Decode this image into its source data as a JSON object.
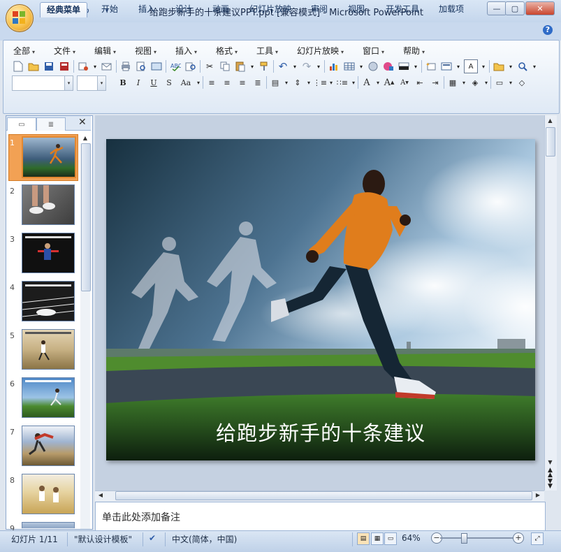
{
  "window": {
    "title": "给跑步新手的十条建议PPT.ppt [兼容模式] - Microsoft PowerPoint"
  },
  "tabs": [
    "经典菜单",
    "开始",
    "插入",
    "设计",
    "动画",
    "幻灯片放映",
    "审阅",
    "视图",
    "开发工具",
    "加载项"
  ],
  "menus": [
    "全部",
    "文件",
    "编辑",
    "视图",
    "插入",
    "格式",
    "工具",
    "幻灯片放映",
    "窗口",
    "帮助"
  ],
  "slide_panel": {
    "numbers": [
      "1",
      "2",
      "3",
      "4",
      "5",
      "6",
      "7",
      "8",
      "9"
    ],
    "selected": "1"
  },
  "slide": {
    "title": "给跑步新手的十条建议"
  },
  "notes": {
    "placeholder": "单击此处添加备注"
  },
  "status": {
    "slide_info": "幻灯片 1/11",
    "theme": "\"默认设计模板\"",
    "language": "中文(简体，中国)",
    "zoom": "64%"
  },
  "colors": {
    "accent_orange": "#e38830",
    "ribbon_blue": "#c9d9ee"
  }
}
